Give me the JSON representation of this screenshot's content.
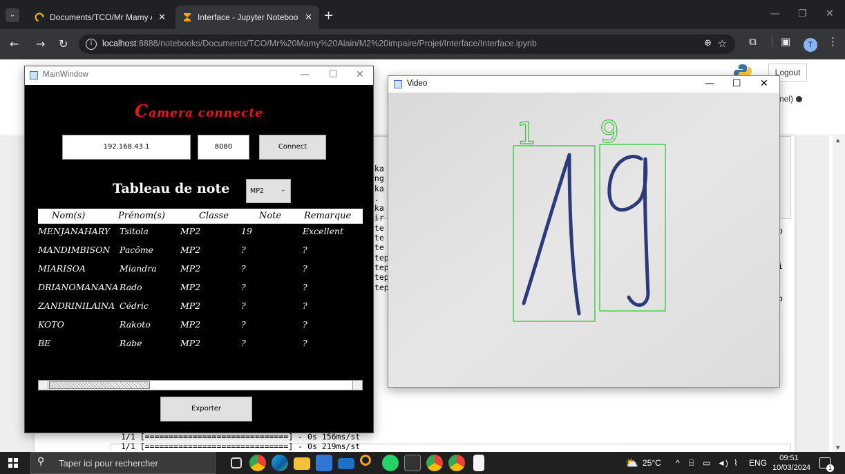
{
  "browser": {
    "tabs": [
      {
        "title": "Documents/TCO/Mr Mamy Alai",
        "active": false
      },
      {
        "title": "Interface - Jupyter Notebook",
        "active": true
      }
    ],
    "url_host": "localhost",
    "url_rest": ":8888/notebooks/Documents/TCO/Mr%20Mamy%20Alain/M2%20impaire/Projet/Interface/Interface.ipynb",
    "profile_initial": "T"
  },
  "jupyter": {
    "logout_label": "Logout",
    "kernel_label": "nel)",
    "output_lines": [
      "kka",
      "rng",
      "",
      "kka",
      "..",
      "",
      "kka",
      "iir",
      "",
      "",
      "",
      "",
      "tte",
      "tte",
      "tte",
      "ttep",
      "ttep",
      "ttep",
      "ttep"
    ],
    "right_markers": [
      "b",
      "i",
      "b"
    ],
    "progress_lines": [
      "1/1 [==============================] - 0s 156ms/st",
      "1/1 [==============================] - 0s 219ms/st"
    ]
  },
  "main_window": {
    "title": "MainWindow",
    "status_first_letter": "C",
    "status_rest": "amera connecte",
    "ip_value": "192.168.43.1",
    "port_value": "8080",
    "connect_label": "Connect",
    "table_title": "Tableau de note",
    "class_selected": "MP2",
    "table_headers": [
      "Nom(s)",
      "Prénom(s)",
      "Classe",
      "Note",
      "Remarque"
    ],
    "table_rows": [
      [
        "MENJANAHARY",
        "Tsitola",
        "MP2",
        "19",
        "Excellent"
      ],
      [
        "MANDIMBISON",
        "Pacôme",
        "MP2",
        "?",
        "?"
      ],
      [
        "MIARISOA",
        "Miandra",
        "MP2",
        "?",
        "?"
      ],
      [
        "DRIANOMANANA",
        "Rado",
        "MP2",
        "?",
        "?"
      ],
      [
        "ZANDRINILAINA",
        "Cédric",
        "MP2",
        "?",
        "?"
      ],
      [
        "KOTO",
        "Rakoto",
        "MP2",
        "?",
        "?"
      ],
      [
        "BE",
        "Rabe",
        "MP2",
        "?",
        "?"
      ]
    ],
    "export_label": "Exporter"
  },
  "video_window": {
    "title": "Video",
    "detections": [
      {
        "label": "1"
      },
      {
        "label": "9"
      }
    ]
  },
  "taskbar": {
    "search_placeholder": "Taper ici pour rechercher",
    "weather": "25°C",
    "language": "ENG",
    "time": "09:51",
    "date": "10/03/2024",
    "notification_count": "1"
  },
  "colors": {
    "status_red": "#e8171b",
    "detect_green": "#39c43a",
    "ink_blue": "#2b3a78"
  }
}
